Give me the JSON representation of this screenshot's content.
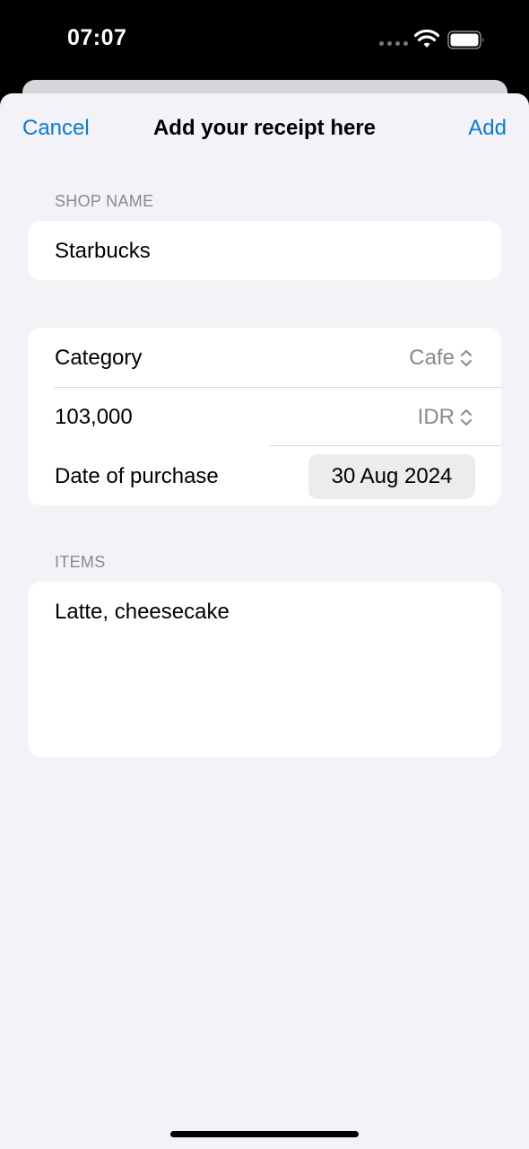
{
  "status_bar": {
    "time": "07:07"
  },
  "nav": {
    "cancel_label": "Cancel",
    "title": "Add your receipt here",
    "add_label": "Add"
  },
  "shop": {
    "header": "SHOP NAME",
    "value": "Starbucks"
  },
  "details": {
    "category_label": "Category",
    "category_value": "Cafe",
    "amount_value": "103,000",
    "currency_value": "IDR",
    "date_label": "Date of purchase",
    "date_value": "30 Aug 2024"
  },
  "items": {
    "header": "ITEMS",
    "value": "Latte, cheesecake"
  },
  "colors": {
    "accent": "#0a7bd1",
    "background": "#f2f2f7",
    "secondary_text": "#8a8a8e"
  },
  "icons": [
    "wifi-icon",
    "battery-icon",
    "up-down-chevron-icon"
  ]
}
